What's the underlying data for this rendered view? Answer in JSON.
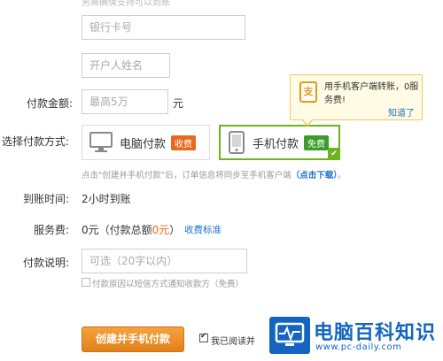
{
  "top_hint": "另需确保支持可以到账",
  "card_number": {
    "placeholder": "银行卡号"
  },
  "holder_name": {
    "placeholder": "开户人姓名"
  },
  "amount": {
    "label": "付款金额:",
    "placeholder": "最高5万",
    "unit": "元"
  },
  "method": {
    "label": "选择付款方式:",
    "options": [
      {
        "label": "电脑付款",
        "tag": "收费",
        "icon": "monitor-icon",
        "selected": false
      },
      {
        "label": "手机付款",
        "tag": "免费",
        "icon": "phone-icon",
        "selected": true
      }
    ],
    "note_prefix": "点击\"创建并手机付款\"后，订单信息将同步至手机客户端",
    "note_link": "（点击下载）",
    "note_suffix": "。"
  },
  "arrival": {
    "label": "到账时间:",
    "value": "2小时到账"
  },
  "fee": {
    "label": "服务费:",
    "value_prefix": "0元（付款总额",
    "value_highlight": "0元",
    "value_suffix": "）",
    "link": "收费标准"
  },
  "description": {
    "label": "付款说明:",
    "placeholder": "可选（20字以内）",
    "sms_option": "付款原因以短信方式通知收款方（免费）"
  },
  "submit": {
    "label": "创建并手机付款"
  },
  "agree": {
    "text": "我已阅读并"
  },
  "tooltip": {
    "icon": "支",
    "text": "用手机客户端转账，0服务费!",
    "link": "知道了"
  },
  "watermark": {
    "title": "电脑百科知识",
    "url": "www.pc-daily.com"
  },
  "colors": {
    "accent_orange": "#e9691f",
    "accent_green": "#6cb31d",
    "link_blue": "#1f73c9"
  }
}
